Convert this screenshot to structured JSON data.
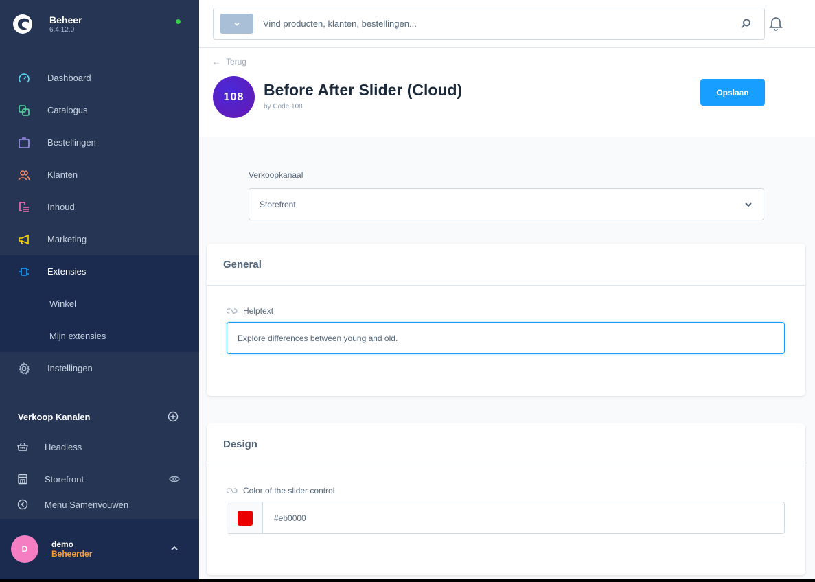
{
  "sidebar": {
    "brand_title": "Beheer",
    "version": "6.4.12.0",
    "nav": [
      {
        "label": "Dashboard",
        "icon": "dashboard-icon",
        "color": "#57d9f3"
      },
      {
        "label": "Catalogus",
        "icon": "catalog-icon",
        "color": "#57d9a3"
      },
      {
        "label": "Bestellingen",
        "icon": "orders-icon",
        "color": "#a092f0"
      },
      {
        "label": "Klanten",
        "icon": "customers-icon",
        "color": "#f88962"
      },
      {
        "label": "Inhoud",
        "icon": "content-icon",
        "color": "#ff68b4"
      },
      {
        "label": "Marketing",
        "icon": "marketing-icon",
        "color": "#ffd700"
      },
      {
        "label": "Extensies",
        "icon": "extensions-icon",
        "color": "#189eff"
      }
    ],
    "sub_items": [
      "Winkel",
      "Mijn extensies"
    ],
    "settings_label": "Instellingen",
    "sales_channels_title": "Verkoop Kanalen",
    "sales_channels": [
      "Headless",
      "Storefront"
    ],
    "collapse_label": "Menu Samenvouwen",
    "user": {
      "initial": "D",
      "name": "demo",
      "role": "Beheerder"
    }
  },
  "topbar": {
    "search_placeholder": "Vind producten, klanten, bestellingen..."
  },
  "header": {
    "back_label": "Terug",
    "logo_text": "108",
    "title": "Before After Slider (Cloud)",
    "subtitle": "by Code 108",
    "save_label": "Opslaan"
  },
  "channel": {
    "label": "Verkoopkanaal",
    "value": "Storefront"
  },
  "cards": {
    "general": {
      "title": "General",
      "field_label": "Helptext",
      "field_value": "Explore differences between young and old."
    },
    "design": {
      "title": "Design",
      "field_label": "Color of the slider control",
      "color_value": "#eb0000"
    }
  }
}
